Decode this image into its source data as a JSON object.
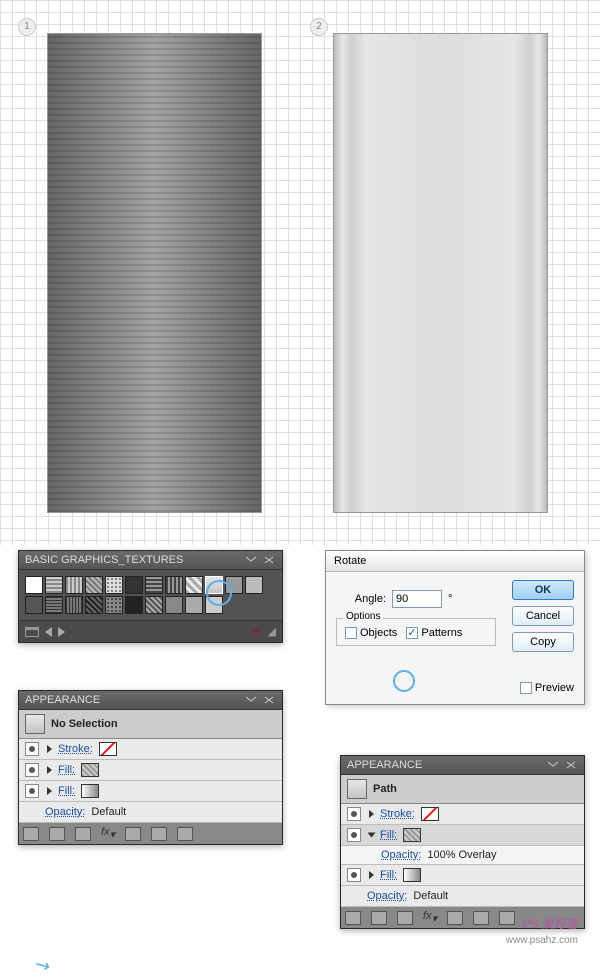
{
  "canvas": {
    "badge1": "1",
    "badge2": "2"
  },
  "swatches": {
    "title": "BASIC GRAPHICS_TEXTURES"
  },
  "appearance1": {
    "title": "APPEARANCE",
    "selection": "No Selection",
    "rows": {
      "stroke": "Stroke:",
      "fill": "Fill:",
      "opacity": "Opacity:",
      "opacity_val": "Default"
    }
  },
  "dialog": {
    "title": "Rotate",
    "angle_label": "Angle:",
    "angle_value": "90",
    "degree": "°",
    "options_label": "Options",
    "objects_label": "Objects",
    "patterns_label": "Patterns",
    "ok": "OK",
    "cancel": "Cancel",
    "copy": "Copy",
    "preview": "Preview"
  },
  "appearance2": {
    "title": "APPEARANCE",
    "selection": "Path",
    "rows": {
      "stroke": "Stroke:",
      "fill": "Fill:",
      "opacity_inner": "Opacity:",
      "opacity_inner_val": "100% Overlay",
      "opacity": "Opacity:",
      "opacity_val": "Default"
    }
  },
  "watermark": {
    "brand": "PS 爱好者",
    "url": "www.psahz.com"
  }
}
